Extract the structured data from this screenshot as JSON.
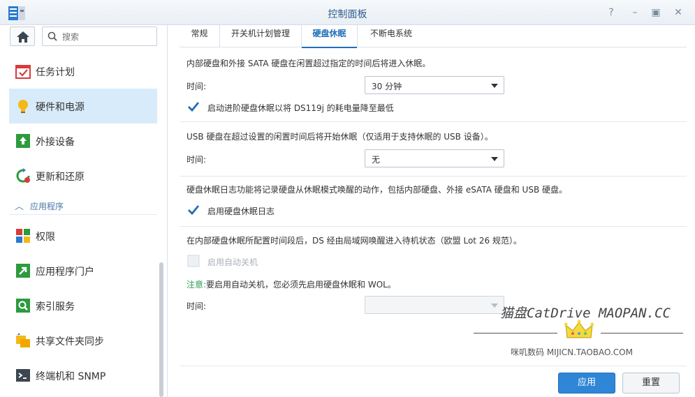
{
  "window": {
    "title": "控制面板"
  },
  "sidebar": {
    "search_placeholder": "搜索",
    "items": [
      {
        "label": "任务计划"
      },
      {
        "label": "硬件和电源"
      },
      {
        "label": "外接设备"
      },
      {
        "label": "更新和还原"
      }
    ],
    "section_label": "应用程序",
    "app_items": [
      {
        "label": "权限"
      },
      {
        "label": "应用程序门户"
      },
      {
        "label": "索引服务"
      },
      {
        "label": "共享文件夹同步"
      },
      {
        "label": "终端机和 SNMP"
      }
    ]
  },
  "tabs": [
    {
      "label": "常规"
    },
    {
      "label": "开关机计划管理"
    },
    {
      "label": "硬盘休眠"
    },
    {
      "label": "不断电系统"
    }
  ],
  "content": {
    "internal": {
      "desc": "内部硬盘和外接 SATA 硬盘在闲置超过指定的时间后将进入休眠。",
      "time_label": "时间:",
      "time_value": "30 分钟",
      "advanced_label": "启动进阶硬盘休眠以将 DS119j 的耗电量降至最低"
    },
    "usb": {
      "desc": "USB 硬盘在超过设置的闲置时间后将开始休眠（仅适用于支持休眠的 USB 设备）。",
      "time_label": "时间:",
      "time_value": "无"
    },
    "log": {
      "desc": "硬盘休眠日志功能将记录硬盘从休眠模式唤醒的动作，包括内部硬盘、外接 eSATA 硬盘和 USB 硬盘。",
      "checkbox_label": "启用硬盘休眠日志"
    },
    "auto_power": {
      "desc": "在内部硬盘休眠所配置时间段后，DS 经由局域网唤醒进入待机状态（欧盟 Lot 26 规范）。",
      "checkbox_label": "启用自动关机",
      "note_prefix": "注意:",
      "note_text": "要启用自动关机，您必须先启用硬盘休眠和 WOL。",
      "time_label": "时间:"
    }
  },
  "buttons": {
    "apply": "应用",
    "reset": "重置"
  },
  "watermark": {
    "line1": "猫盘CatDrive MAOPAN.CC",
    "line2": "咪叽数码 MIJICN.TAOBAO.COM"
  },
  "colors": {
    "accent": "#2f86d6",
    "active_nav_bg": "#d8ebfb",
    "note_green": "#2f9c5a"
  }
}
